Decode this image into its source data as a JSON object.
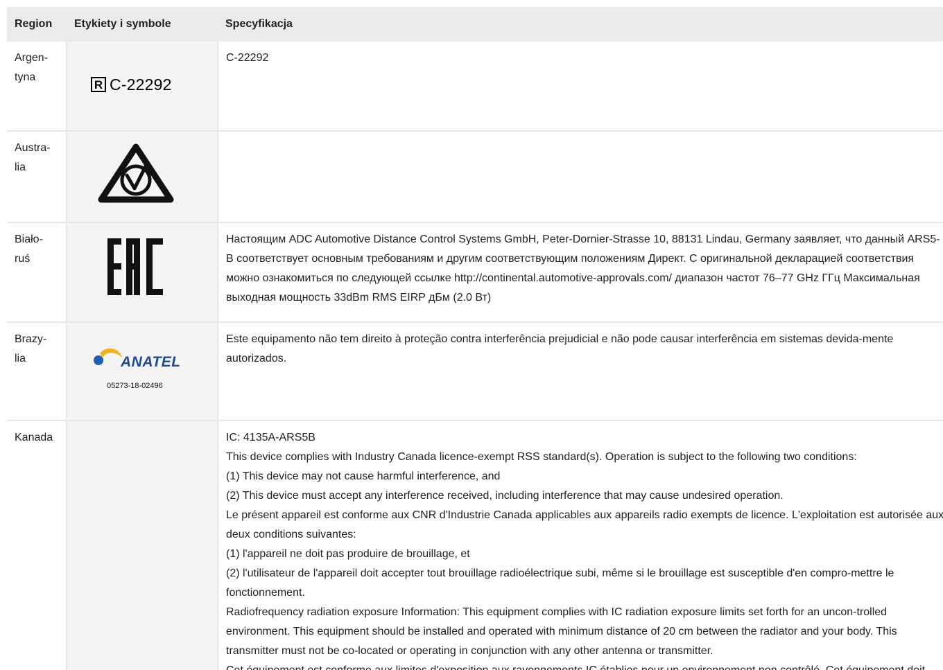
{
  "table": {
    "headers": {
      "region": "Region",
      "symbols": "Etykiety i symbole",
      "spec": "Specyfikacja"
    },
    "rows": [
      {
        "region": "Argen-\ntyna",
        "symbol": {
          "icon": "registered-r-icon",
          "text": "C-22292"
        },
        "spec": [
          "C-22292"
        ]
      },
      {
        "region": "Austra-\nlia",
        "symbol": {
          "icon": "rcm-compliance-mark-icon"
        },
        "spec": []
      },
      {
        "region": "Biało-\nruś",
        "symbol": {
          "icon": "eac-mark-icon"
        },
        "spec": [
          "Настоящим ADC Automotive Distance Control Systems GmbH, Peter-Dornier-Strasse 10, 88131 Lindau, Germany заявляет, что данный ARS5-B соответствует основным требованиям и другим соответствующим положениям Директ. С оригинальной декларацией соответствия можно ознакомиться по следующей ссылке http://continental.automotive-approvals.com/ диапазон частот 76–77 GHz ГГц Максимальная выходная мощность 33dBm RMS EIRP дБм (2.0 Вт)"
        ]
      },
      {
        "region": "Brazy-\nlia",
        "symbol": {
          "icon": "anatel-logo-icon",
          "text": "ANATEL",
          "number": "05273-18-02496"
        },
        "spec": [
          "Este equipamento não tem direito à proteção contra interferência prejudicial e não pode causar interferência em sistemas devida-mente autorizados."
        ]
      },
      {
        "region": "Kanada",
        "symbol": null,
        "spec": [
          "IC: 4135A-ARS5B",
          "This device complies with Industry Canada licence-exempt RSS standard(s). Operation is subject to the following two conditions:",
          "(1) This device may not cause harmful interference, and",
          "(2) This device must accept any interference received, including interference that may cause undesired operation.",
          "Le présent appareil est conforme aux CNR d'Industrie Canada applicables aux appareils radio exempts de licence. L'exploitation est autorisée aux deux conditions suivantes:",
          "(1) l'appareil ne doit pas produire de brouillage, et",
          "(2) l'utilisateur de l'appareil doit accepter tout brouillage radioélectrique subi, même si le brouillage est susceptible d'en compro-mettre le fonctionnement.",
          "Radiofrequency radiation exposure Information: This equipment complies with IC radiation exposure limits set forth for an uncon-trolled environment. This equipment should be installed and operated with minimum distance of 20 cm between the radiator and your body. This transmitter must not be co-located or operating in conjunction with any other antenna or transmitter.",
          "Cet équipement est conforme aux limites d'exposition aux rayonnements IC établies pour un environnement non contrôlé. Cet équipement doit être installé et utilisé avec un minimum de 20 cm de distance entre la source de rayonnement et votre corps."
        ]
      }
    ]
  }
}
